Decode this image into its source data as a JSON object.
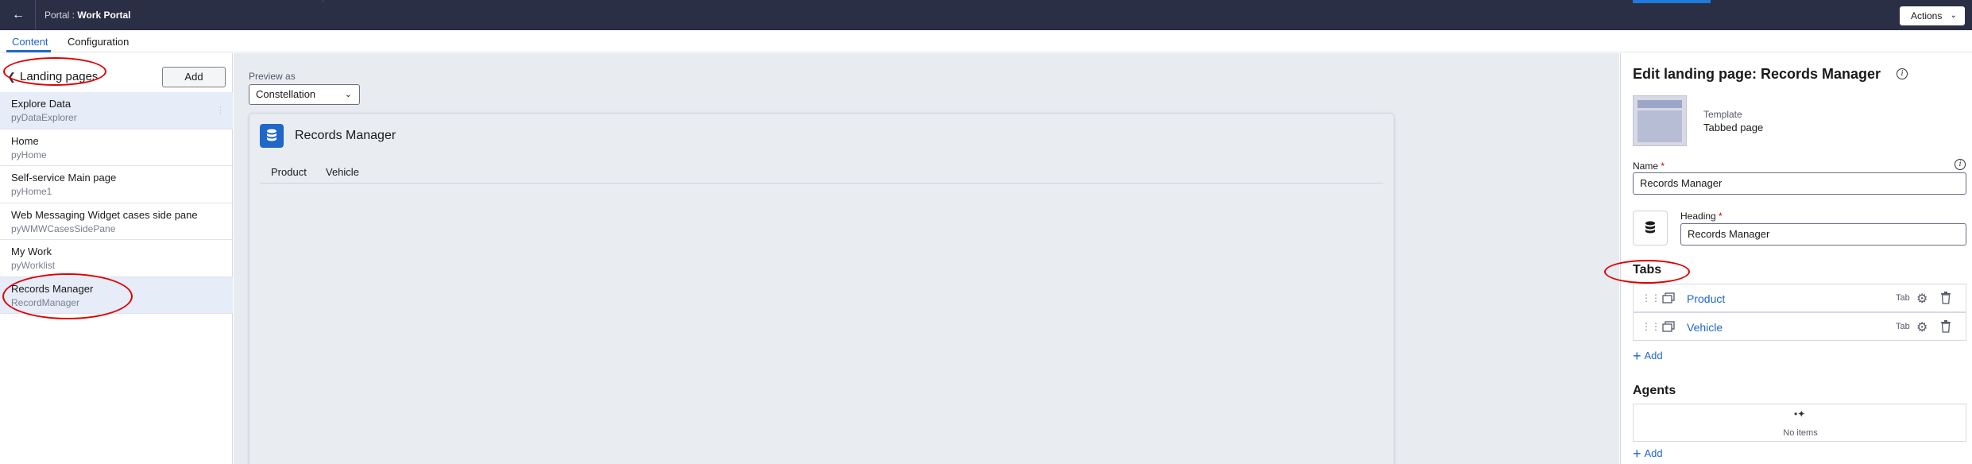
{
  "topbar": {
    "title_prefix": "Portal : ",
    "title_name": "Work Portal",
    "actions_label": "Actions"
  },
  "tabs": [
    {
      "label": "Content",
      "active": true
    },
    {
      "label": "Configuration",
      "active": false
    }
  ],
  "left": {
    "heading": "Landing pages",
    "add_label": "Add",
    "items": [
      {
        "title": "Explore Data",
        "sub": "pyDataExplorer",
        "selected": true
      },
      {
        "title": "Home",
        "sub": "pyHome",
        "selected": false
      },
      {
        "title": "Self-service Main page",
        "sub": "pyHome1",
        "selected": false
      },
      {
        "title": "Web Messaging Widget cases side pane",
        "sub": "pyWMWCasesSidePane",
        "selected": false
      },
      {
        "title": "My Work",
        "sub": "pyWorklist",
        "selected": false
      },
      {
        "title": "Records Manager",
        "sub": "RecordManager",
        "selected": true
      }
    ]
  },
  "preview": {
    "label": "Preview as",
    "selected": "Constellation",
    "card_title": "Records Manager",
    "tabs": [
      "Product",
      "Vehicle"
    ]
  },
  "right": {
    "heading": "Edit landing page: Records Manager",
    "template_label": "Template",
    "template_value": "Tabbed page",
    "name_label": "Name",
    "name_value": "Records Manager",
    "heading_label": "Heading",
    "heading_value": "Records Manager",
    "required_mark": "*",
    "tabs_section": "Tabs",
    "tab_rows": [
      {
        "name": "Product",
        "type": "Tab"
      },
      {
        "name": "Vehicle",
        "type": "Tab"
      }
    ],
    "add_label": "Add",
    "agents_section": "Agents",
    "agents_empty": "No items"
  },
  "colors": {
    "topbar": "#2b2f45",
    "accent": "#1f67c9",
    "annotation": "#e00000"
  }
}
